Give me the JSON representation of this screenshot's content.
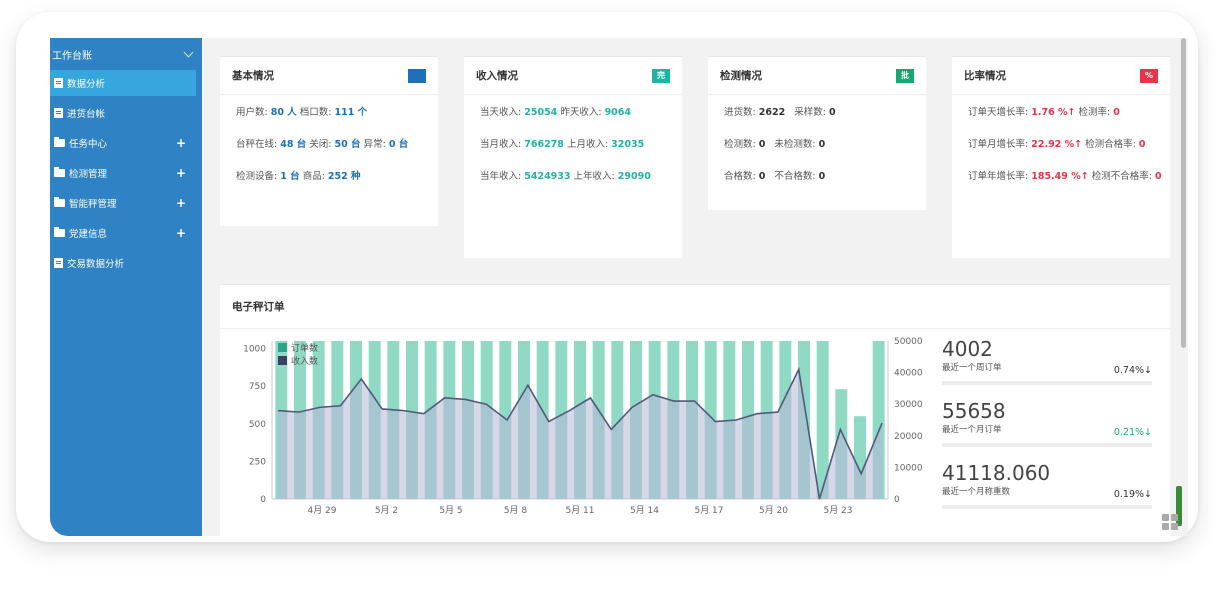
{
  "sidebar": {
    "header": "工作台账",
    "items": [
      {
        "label": "数据分析",
        "icon": "doc-icon",
        "active": true,
        "plus": ""
      },
      {
        "label": "进货台帐",
        "icon": "doc-icon",
        "active": false,
        "plus": ""
      },
      {
        "label": "任务中心",
        "icon": "folder-icon",
        "active": false,
        "plus": "+"
      },
      {
        "label": "检测管理",
        "icon": "folder-icon",
        "active": false,
        "plus": "+"
      },
      {
        "label": "智能秤管理",
        "icon": "folder-icon",
        "active": false,
        "plus": "+"
      },
      {
        "label": "党建信息",
        "icon": "folder-icon",
        "active": false,
        "plus": "+"
      },
      {
        "label": "交易数据分析",
        "icon": "doc-icon",
        "active": false,
        "plus": ""
      }
    ]
  },
  "cards": {
    "basic": {
      "title": "基本情况",
      "badge": "",
      "badge_color": "#1e70b8",
      "users_label": "用户数:",
      "users_value": "80 人",
      "stalls_label": "档口数:",
      "stalls_value": "111 个",
      "scales_online_label": "台秤在线:",
      "scales_online_value": "48 台",
      "scales_off_label": "关闭:",
      "scales_off_value": "50 台",
      "scales_abn_label": "异常:",
      "scales_abn_value": "0 台",
      "devices_label": "检测设备:",
      "devices_value": "1 台",
      "goods_label": "商品:",
      "goods_value": "252 种"
    },
    "income": {
      "title": "收入情况",
      "badge": "完",
      "badge_color": "#22b3a3",
      "today_label": "当天收入:",
      "today_value": "25054",
      "yesterday_label": "昨天收入:",
      "yesterday_value": "9064",
      "month_label": "当月收入:",
      "month_value": "766278",
      "last_month_label": "上月收入:",
      "last_month_value": "32035",
      "year_label": "当年收入:",
      "year_value": "5424933",
      "last_year_label": "上年收入:",
      "last_year_value": "29090"
    },
    "inspection": {
      "title": "检测情况",
      "badge": "批",
      "badge_color": "#1aa572",
      "stock_label": "进货数:",
      "stock_value": "2622",
      "sample_label": "采样数:",
      "sample_value": "0",
      "tested_label": "检测数:",
      "tested_value": "0",
      "untested_label": "未检测数:",
      "untested_value": "0",
      "pass_label": "合格数:",
      "pass_value": "0",
      "fail_label": "不合格数:",
      "fail_value": "0"
    },
    "ratio": {
      "title": "比率情况",
      "badge": "%",
      "badge_color": "#e8334a",
      "day_label": "订单天增长率:",
      "day_value": "1.76 %",
      "day_rate_label": "检测率:",
      "day_rate_value": "0",
      "month_label": "订单月增长率:",
      "month_value": "22.92 %",
      "month_rate_label": "检测合格率:",
      "month_rate_value": "0",
      "year_label": "订单年增长率:",
      "year_value": "185.49 %",
      "year_rate_label": "检测不合格率:",
      "year_rate_value": "0"
    }
  },
  "panel": {
    "title": "电子秤订单",
    "stats": [
      {
        "value": "4002",
        "label": "最近一个周订单",
        "pct": "0.74%",
        "pct_color": "dark"
      },
      {
        "value": "55658",
        "label": "最近一个月订单",
        "pct": "0.21%",
        "pct_color": "green"
      },
      {
        "value": "41118.060",
        "label": "最近一个月称重数",
        "pct": "0.19%",
        "pct_color": "dark"
      }
    ]
  },
  "chart_data": {
    "type": "bar",
    "legend": [
      "订单数",
      "收入数"
    ],
    "x_ticks": [
      "4月 29",
      "5月 2",
      "5月 5",
      "5月 8",
      "5月 11",
      "5月 14",
      "5月 17",
      "5月 20",
      "5月 23"
    ],
    "y_left_ticks": [
      "0",
      "250",
      "500",
      "750",
      "1000"
    ],
    "y_right_ticks": [
      "0",
      "10000",
      "20000",
      "30000",
      "40000",
      "50000"
    ],
    "ylim_left": [
      0,
      1050
    ],
    "ylim_right": [
      0,
      50000
    ],
    "bar_values": [
      1050,
      1050,
      1050,
      1050,
      1050,
      1050,
      1050,
      1050,
      1050,
      1050,
      1050,
      1050,
      1050,
      1050,
      1050,
      1050,
      1050,
      1050,
      1050,
      1050,
      1050,
      1050,
      1050,
      1050,
      1050,
      1050,
      1050,
      1050,
      1050,
      1050,
      730,
      550,
      1050
    ],
    "line_values": [
      28000,
      27500,
      29000,
      29500,
      38000,
      28500,
      28000,
      27000,
      32000,
      31500,
      30000,
      25000,
      36000,
      24500,
      28000,
      32000,
      22000,
      29000,
      33000,
      31000,
      31000,
      24500,
      25000,
      27000,
      27500,
      41000,
      0,
      22000,
      8000,
      24000
    ],
    "bar_color": "#8fd9c5",
    "line_color": "#525a7a",
    "area_color": "#b8b6d8"
  }
}
